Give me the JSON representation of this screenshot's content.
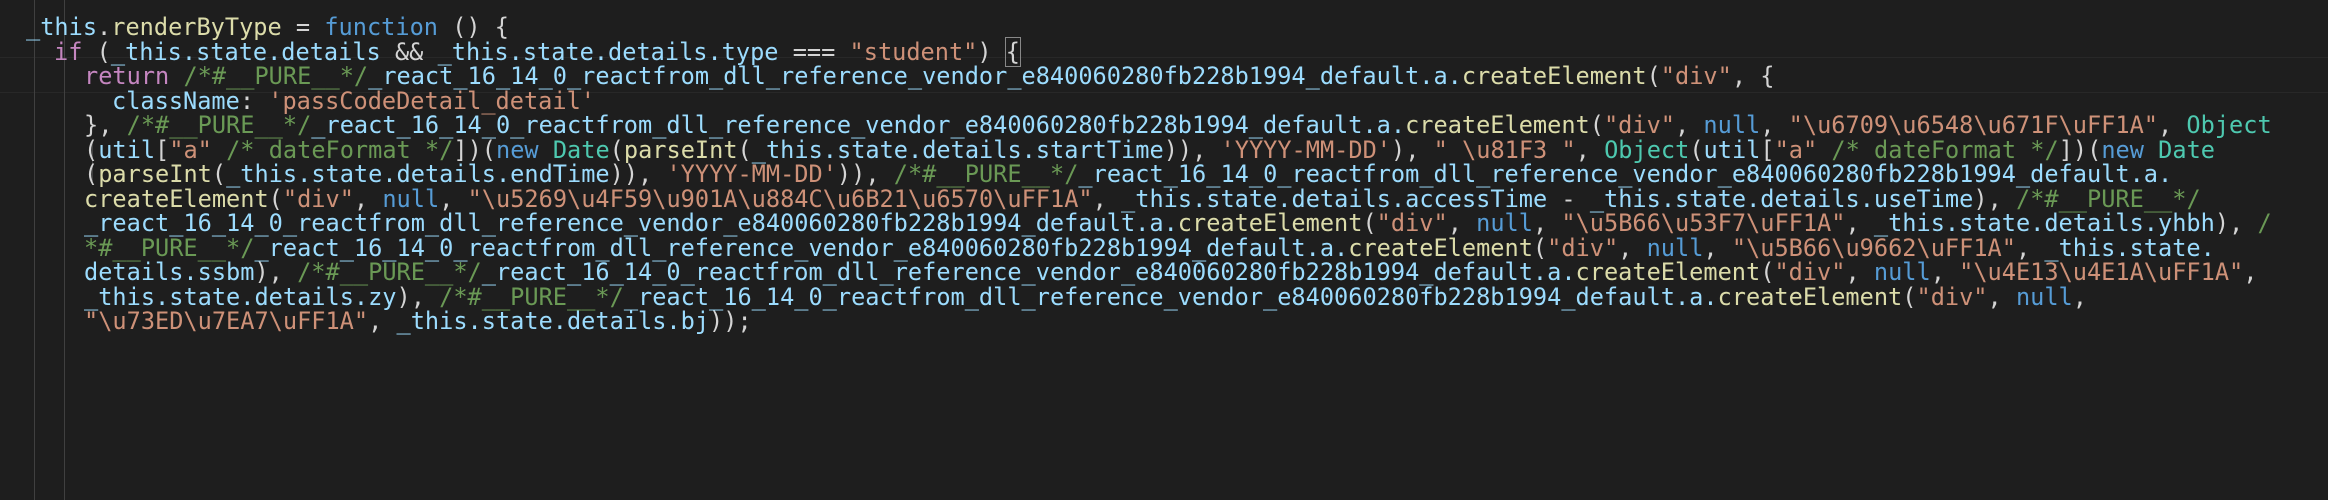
{
  "editor": {
    "lines": [
      {
        "indent": 26,
        "tokens": [
          {
            "t": "_this",
            "c": "var"
          },
          {
            "t": ".",
            "c": "pn"
          },
          {
            "t": "renderByType",
            "c": "fn"
          },
          {
            "t": " = ",
            "c": "op"
          },
          {
            "t": "function",
            "c": "kw"
          },
          {
            "t": " () {",
            "c": "pn"
          }
        ]
      },
      {
        "indent": 54,
        "tokens": [
          {
            "t": "if",
            "c": "ctrl"
          },
          {
            "t": " (",
            "c": "pn"
          },
          {
            "t": "_this",
            "c": "var"
          },
          {
            "t": ".state.details ",
            "c": "prop"
          },
          {
            "t": "&&",
            "c": "op"
          },
          {
            "t": " _this",
            "c": "var"
          },
          {
            "t": ".state.details.type ",
            "c": "prop"
          },
          {
            "t": "===",
            "c": "op"
          },
          {
            "t": " \"student\"",
            "c": "str"
          },
          {
            "t": ") ",
            "c": "pn"
          },
          {
            "t": "{",
            "c": "br"
          }
        ]
      },
      {
        "indent": 84,
        "tokens": [
          {
            "t": "return",
            "c": "ctrl"
          },
          {
            "t": " /*#__PURE__*/",
            "c": "cmt"
          },
          {
            "t": "_react_16_14_0_reactfrom_dll_reference_vendor_e840060280fb228b1994_default",
            "c": "var"
          },
          {
            "t": ".a.",
            "c": "prop"
          },
          {
            "t": "createElement",
            "c": "fn"
          },
          {
            "t": "(",
            "c": "pn"
          },
          {
            "t": "\"div\"",
            "c": "str"
          },
          {
            "t": ", {",
            "c": "pn"
          }
        ]
      },
      {
        "indent": 112,
        "tokens": [
          {
            "t": "className",
            "c": "prop"
          },
          {
            "t": ": ",
            "c": "pn"
          },
          {
            "t": "'passCodeDetail_detail'",
            "c": "str"
          }
        ]
      },
      {
        "indent": 84,
        "tokens": [
          {
            "t": "}, ",
            "c": "pn"
          },
          {
            "t": "/*#__PURE__*/",
            "c": "cmt"
          },
          {
            "t": "_react_16_14_0_reactfrom_dll_reference_vendor_e840060280fb228b1994_default",
            "c": "var"
          },
          {
            "t": ".a.",
            "c": "prop"
          },
          {
            "t": "createElement",
            "c": "fn"
          },
          {
            "t": "(",
            "c": "pn"
          },
          {
            "t": "\"div\"",
            "c": "str"
          },
          {
            "t": ", ",
            "c": "pn"
          },
          {
            "t": "null",
            "c": "kw"
          },
          {
            "t": ", ",
            "c": "pn"
          },
          {
            "t": "\"\\u6709\\u6548\\u671F\\uFF1A\"",
            "c": "str"
          },
          {
            "t": ", ",
            "c": "pn"
          },
          {
            "t": "Object",
            "c": "cls"
          }
        ]
      },
      {
        "indent": 84,
        "tokens": [
          {
            "t": "(",
            "c": "pn"
          },
          {
            "t": "util",
            "c": "var"
          },
          {
            "t": "[",
            "c": "pn"
          },
          {
            "t": "\"a\"",
            "c": "str"
          },
          {
            "t": " /* dateFormat */",
            "c": "cmt"
          },
          {
            "t": "])(",
            "c": "pn"
          },
          {
            "t": "new",
            "c": "kw"
          },
          {
            "t": " ",
            "c": "pn"
          },
          {
            "t": "Date",
            "c": "cls"
          },
          {
            "t": "(",
            "c": "pn"
          },
          {
            "t": "parseInt",
            "c": "fn"
          },
          {
            "t": "(",
            "c": "pn"
          },
          {
            "t": "_this",
            "c": "var"
          },
          {
            "t": ".state.details.startTime",
            "c": "prop"
          },
          {
            "t": ")), ",
            "c": "pn"
          },
          {
            "t": "'YYYY-MM-DD'",
            "c": "str"
          },
          {
            "t": "), ",
            "c": "pn"
          },
          {
            "t": "\" \\u81F3 \"",
            "c": "str"
          },
          {
            "t": ", ",
            "c": "pn"
          },
          {
            "t": "Object",
            "c": "cls"
          },
          {
            "t": "(",
            "c": "pn"
          },
          {
            "t": "util",
            "c": "var"
          },
          {
            "t": "[",
            "c": "pn"
          },
          {
            "t": "\"a\"",
            "c": "str"
          },
          {
            "t": " /* dateFormat */",
            "c": "cmt"
          },
          {
            "t": "])(",
            "c": "pn"
          },
          {
            "t": "new",
            "c": "kw"
          },
          {
            "t": " ",
            "c": "pn"
          },
          {
            "t": "Date",
            "c": "cls"
          }
        ]
      },
      {
        "indent": 84,
        "tokens": [
          {
            "t": "(",
            "c": "pn"
          },
          {
            "t": "parseInt",
            "c": "fn"
          },
          {
            "t": "(",
            "c": "pn"
          },
          {
            "t": "_this",
            "c": "var"
          },
          {
            "t": ".state.details.endTime",
            "c": "prop"
          },
          {
            "t": ")), ",
            "c": "pn"
          },
          {
            "t": "'YYYY-MM-DD'",
            "c": "str"
          },
          {
            "t": ")), ",
            "c": "pn"
          },
          {
            "t": "/*#__PURE__*/",
            "c": "cmt"
          },
          {
            "t": "_react_16_14_0_reactfrom_dll_reference_vendor_e840060280fb228b1994_default",
            "c": "var"
          },
          {
            "t": ".a.",
            "c": "prop"
          }
        ]
      },
      {
        "indent": 84,
        "tokens": [
          {
            "t": "createElement",
            "c": "fn"
          },
          {
            "t": "(",
            "c": "pn"
          },
          {
            "t": "\"div\"",
            "c": "str"
          },
          {
            "t": ", ",
            "c": "pn"
          },
          {
            "t": "null",
            "c": "kw"
          },
          {
            "t": ", ",
            "c": "pn"
          },
          {
            "t": "\"\\u5269\\u4F59\\u901A\\u884C\\u6B21\\u6570\\uFF1A\"",
            "c": "str"
          },
          {
            "t": ", ",
            "c": "pn"
          },
          {
            "t": "_this",
            "c": "var"
          },
          {
            "t": ".state.details.accessTime ",
            "c": "prop"
          },
          {
            "t": "-",
            "c": "op"
          },
          {
            "t": " _this",
            "c": "var"
          },
          {
            "t": ".state.details.useTime",
            "c": "prop"
          },
          {
            "t": "), ",
            "c": "pn"
          },
          {
            "t": "/*#__PURE__*/",
            "c": "cmt"
          }
        ]
      },
      {
        "indent": 84,
        "tokens": [
          {
            "t": "_react_16_14_0_reactfrom_dll_reference_vendor_e840060280fb228b1994_default",
            "c": "var"
          },
          {
            "t": ".a.",
            "c": "prop"
          },
          {
            "t": "createElement",
            "c": "fn"
          },
          {
            "t": "(",
            "c": "pn"
          },
          {
            "t": "\"div\"",
            "c": "str"
          },
          {
            "t": ", ",
            "c": "pn"
          },
          {
            "t": "null",
            "c": "kw"
          },
          {
            "t": ", ",
            "c": "pn"
          },
          {
            "t": "\"\\u5B66\\u53F7\\uFF1A\"",
            "c": "str"
          },
          {
            "t": ", ",
            "c": "pn"
          },
          {
            "t": "_this",
            "c": "var"
          },
          {
            "t": ".state.details.yhbh",
            "c": "prop"
          },
          {
            "t": "), ",
            "c": "pn"
          },
          {
            "t": "/",
            "c": "cmt"
          }
        ]
      },
      {
        "indent": 84,
        "tokens": [
          {
            "t": "*#__PURE__*/",
            "c": "cmt"
          },
          {
            "t": "_react_16_14_0_reactfrom_dll_reference_vendor_e840060280fb228b1994_default",
            "c": "var"
          },
          {
            "t": ".a.",
            "c": "prop"
          },
          {
            "t": "createElement",
            "c": "fn"
          },
          {
            "t": "(",
            "c": "pn"
          },
          {
            "t": "\"div\"",
            "c": "str"
          },
          {
            "t": ", ",
            "c": "pn"
          },
          {
            "t": "null",
            "c": "kw"
          },
          {
            "t": ", ",
            "c": "pn"
          },
          {
            "t": "\"\\u5B66\\u9662\\uFF1A\"",
            "c": "str"
          },
          {
            "t": ", ",
            "c": "pn"
          },
          {
            "t": "_this",
            "c": "var"
          },
          {
            "t": ".state.",
            "c": "prop"
          }
        ]
      },
      {
        "indent": 84,
        "tokens": [
          {
            "t": "details.ssbm",
            "c": "prop"
          },
          {
            "t": "), ",
            "c": "pn"
          },
          {
            "t": "/*#__PURE__*/",
            "c": "cmt"
          },
          {
            "t": "_react_16_14_0_reactfrom_dll_reference_vendor_e840060280fb228b1994_default",
            "c": "var"
          },
          {
            "t": ".a.",
            "c": "prop"
          },
          {
            "t": "createElement",
            "c": "fn"
          },
          {
            "t": "(",
            "c": "pn"
          },
          {
            "t": "\"div\"",
            "c": "str"
          },
          {
            "t": ", ",
            "c": "pn"
          },
          {
            "t": "null",
            "c": "kw"
          },
          {
            "t": ", ",
            "c": "pn"
          },
          {
            "t": "\"\\u4E13\\u4E1A\\uFF1A\"",
            "c": "str"
          },
          {
            "t": ",",
            "c": "pn"
          }
        ]
      },
      {
        "indent": 84,
        "tokens": [
          {
            "t": "_this",
            "c": "var"
          },
          {
            "t": ".state.details.zy",
            "c": "prop"
          },
          {
            "t": "), ",
            "c": "pn"
          },
          {
            "t": "/*#__PURE__*/",
            "c": "cmt"
          },
          {
            "t": "_react_16_14_0_reactfrom_dll_reference_vendor_e840060280fb228b1994_default",
            "c": "var"
          },
          {
            "t": ".a.",
            "c": "prop"
          },
          {
            "t": "createElement",
            "c": "fn"
          },
          {
            "t": "(",
            "c": "pn"
          },
          {
            "t": "\"div\"",
            "c": "str"
          },
          {
            "t": ", ",
            "c": "pn"
          },
          {
            "t": "null",
            "c": "kw"
          },
          {
            "t": ",",
            "c": "pn"
          }
        ]
      },
      {
        "indent": 84,
        "tokens": [
          {
            "t": "\"\\u73ED\\u7EA7\\uFF1A\"",
            "c": "str"
          },
          {
            "t": ", ",
            "c": "pn"
          },
          {
            "t": "_this",
            "c": "var"
          },
          {
            "t": ".state.details.bj",
            "c": "prop"
          },
          {
            "t": "));",
            "c": "pn"
          }
        ]
      }
    ]
  },
  "theme": {
    "background": "#1e1e1e",
    "keyword": "#569cd6",
    "control": "#c586c0",
    "string": "#ce9178",
    "comment": "#6a9955",
    "function": "#dcdcaa",
    "class": "#4ec9b0",
    "variable": "#9cdcfe"
  }
}
